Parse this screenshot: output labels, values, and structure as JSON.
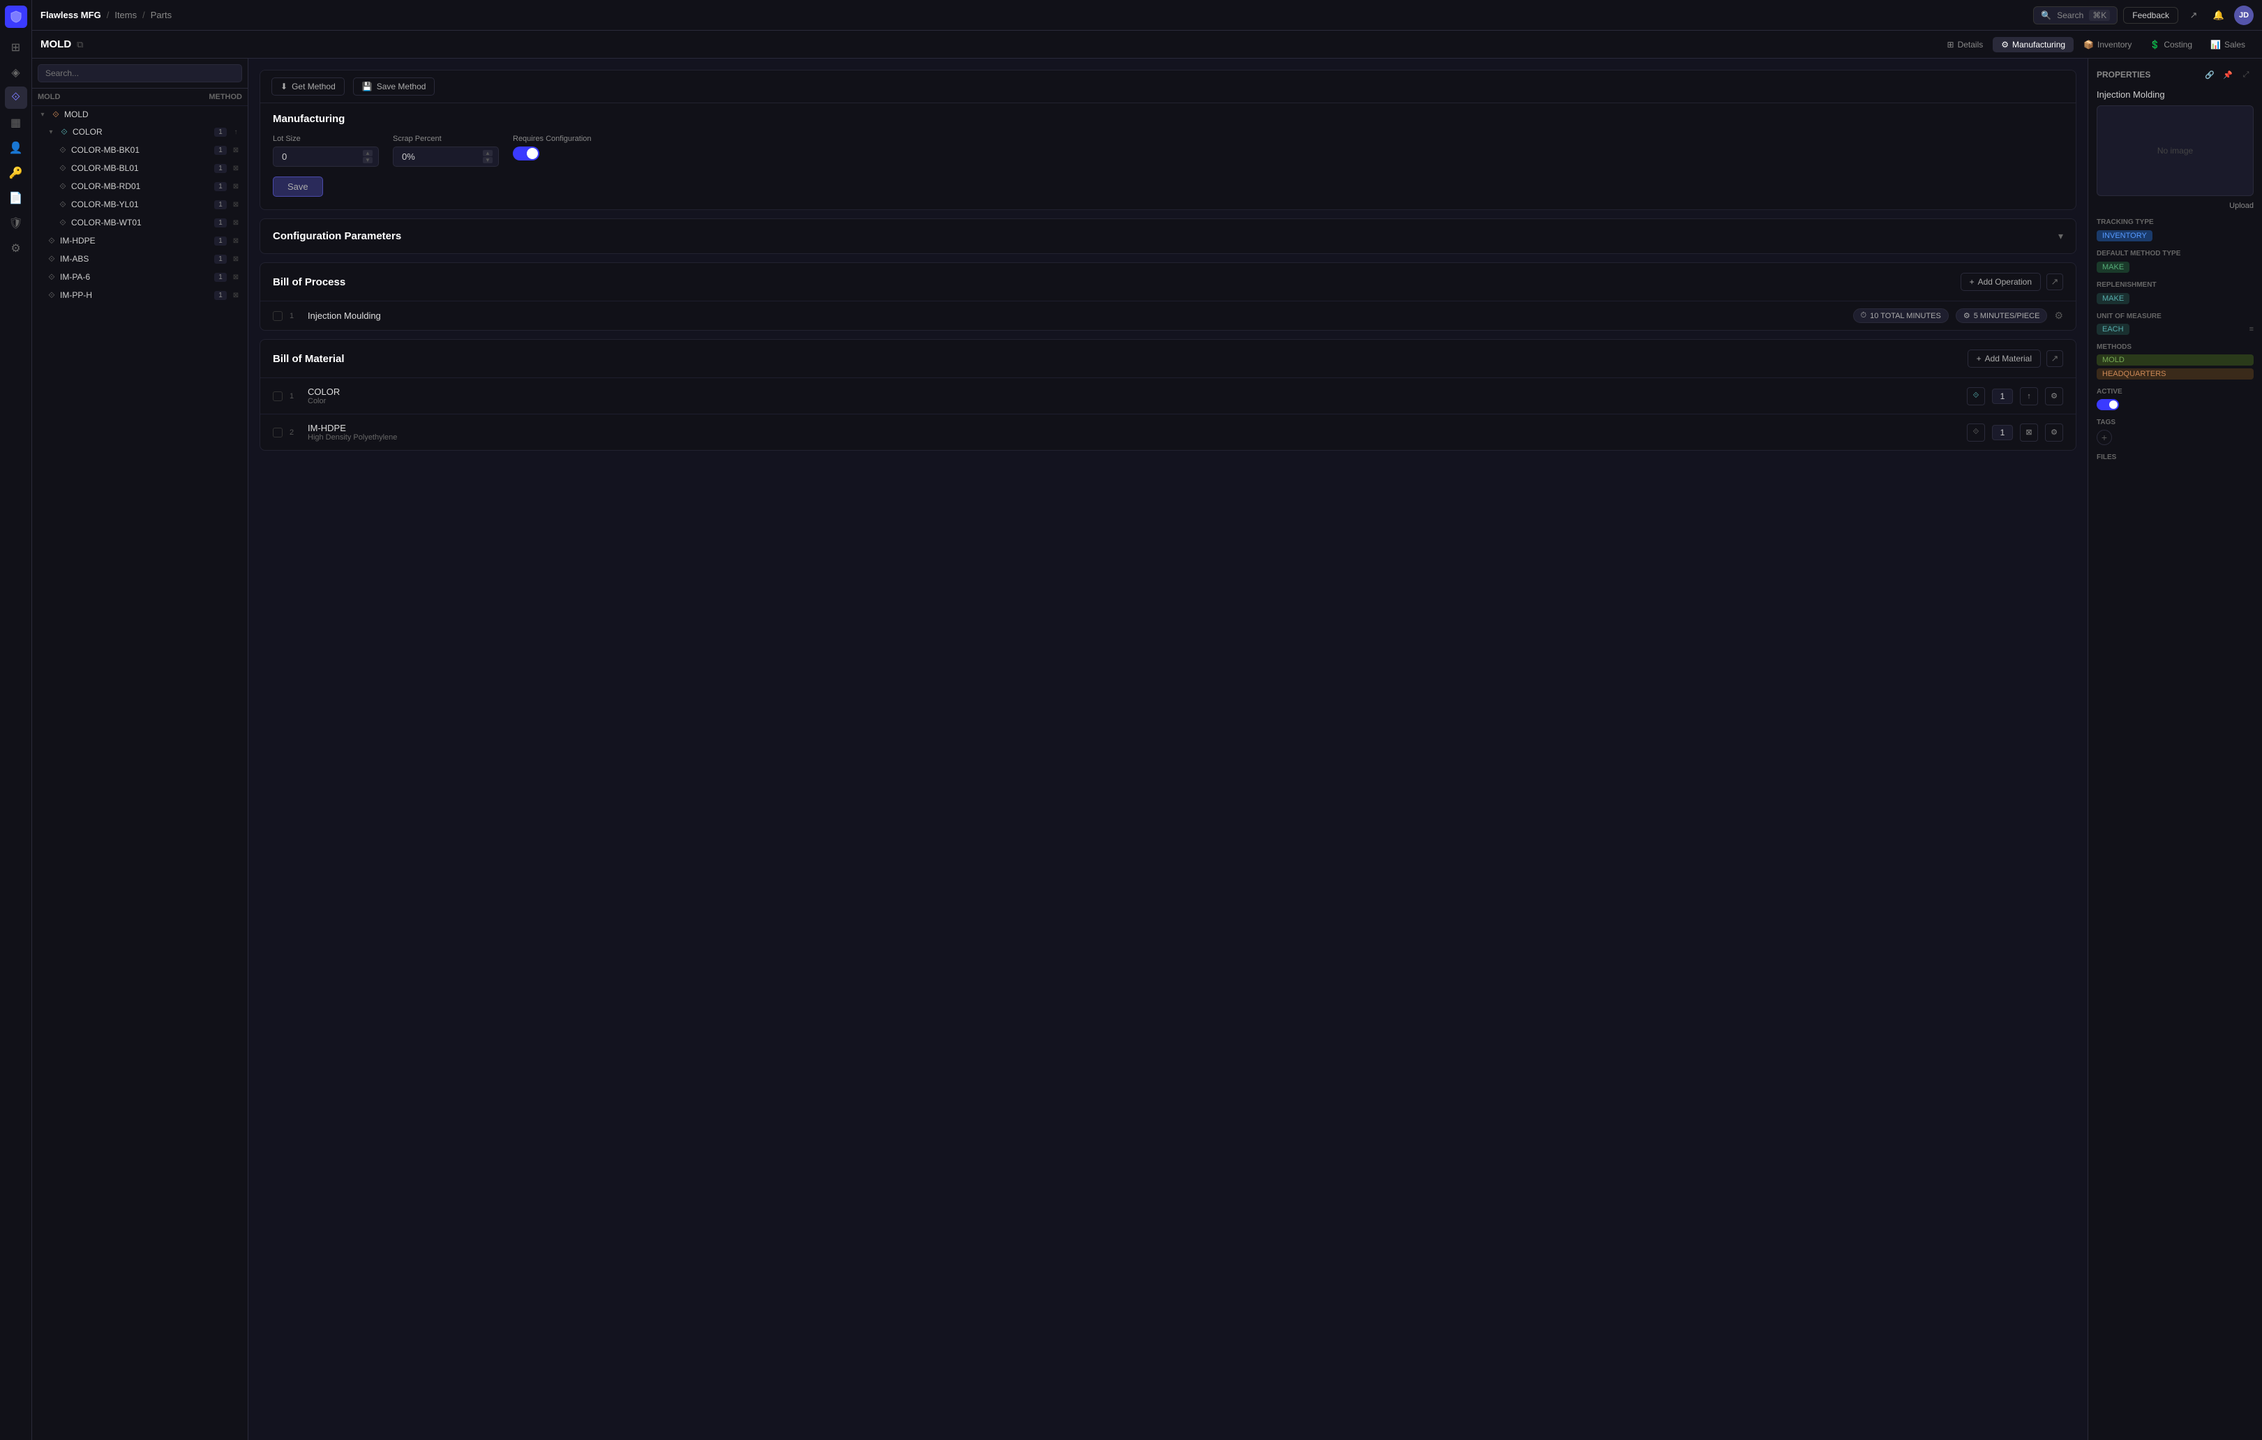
{
  "app": {
    "name": "Flawless MFG",
    "breadcrumbs": [
      "Items",
      "Parts"
    ],
    "page_title": "MOLD"
  },
  "topnav": {
    "search_placeholder": "Search",
    "search_shortcut": "⌘K",
    "feedback_label": "Feedback",
    "tabs": [
      {
        "id": "details",
        "label": "Details",
        "icon": "⊞"
      },
      {
        "id": "manufacturing",
        "label": "Manufacturing",
        "icon": "⚙",
        "active": true
      },
      {
        "id": "inventory",
        "label": "Inventory",
        "icon": "📦"
      },
      {
        "id": "costing",
        "label": "Costing",
        "icon": "💲"
      },
      {
        "id": "sales",
        "label": "Sales",
        "icon": "📊"
      }
    ]
  },
  "tree": {
    "search_placeholder": "Search...",
    "header": {
      "name_col": "MOLD",
      "method_col": "METHOD"
    },
    "items": [
      {
        "id": "mold",
        "label": "MOLD",
        "indent": 0,
        "badge": "",
        "icon": "orange",
        "expanded": true
      },
      {
        "id": "color",
        "label": "COLOR",
        "indent": 1,
        "badge": "1",
        "icon": "teal",
        "expanded": true
      },
      {
        "id": "color-mb-bk01",
        "label": "COLOR-MB-BK01",
        "indent": 2,
        "badge": "1",
        "icon": "gray"
      },
      {
        "id": "color-mb-bl01",
        "label": "COLOR-MB-BL01",
        "indent": 2,
        "badge": "1",
        "icon": "gray"
      },
      {
        "id": "color-mb-rd01",
        "label": "COLOR-MB-RD01",
        "indent": 2,
        "badge": "1",
        "icon": "gray"
      },
      {
        "id": "color-mb-yl01",
        "label": "COLOR-MB-YL01",
        "indent": 2,
        "badge": "1",
        "icon": "gray"
      },
      {
        "id": "color-mb-wt01",
        "label": "COLOR-MB-WT01",
        "indent": 2,
        "badge": "1",
        "icon": "gray"
      },
      {
        "id": "im-hdpe",
        "label": "IM-HDPE",
        "indent": 1,
        "badge": "1",
        "icon": "gray"
      },
      {
        "id": "im-abs",
        "label": "IM-ABS",
        "indent": 1,
        "badge": "1",
        "icon": "gray"
      },
      {
        "id": "im-pa-6",
        "label": "IM-PA-6",
        "indent": 1,
        "badge": "1",
        "icon": "gray"
      },
      {
        "id": "im-pp-h",
        "label": "IM-PP-H",
        "indent": 1,
        "badge": "1",
        "icon": "gray"
      }
    ]
  },
  "manufacturing": {
    "title": "Manufacturing",
    "get_method_label": "Get Method",
    "save_method_label": "Save Method",
    "lot_size_label": "Lot Size",
    "lot_size_value": "0",
    "scrap_percent_label": "Scrap Percent",
    "scrap_percent_value": "0%",
    "requires_config_label": "Requires Configuration",
    "requires_config_on": true,
    "save_label": "Save"
  },
  "config_params": {
    "title": "Configuration Parameters"
  },
  "bill_of_process": {
    "title": "Bill of Process",
    "add_operation_label": "Add Operation",
    "operations": [
      {
        "num": "1",
        "name": "Injection Moulding",
        "total_minutes": "10 TOTAL MINUTES",
        "per_piece": "5 MINUTES/PIECE"
      }
    ]
  },
  "bill_of_material": {
    "title": "Bill of Material",
    "add_material_label": "Add Material",
    "materials": [
      {
        "num": "1",
        "name": "COLOR",
        "sub": "Color",
        "qty": "1",
        "icon": "teal"
      },
      {
        "num": "2",
        "name": "IM-HDPE",
        "sub": "High Density Polyethylene",
        "qty": "1",
        "icon": "gray"
      }
    ]
  },
  "properties": {
    "title": "Properties",
    "item_name": "Injection Molding",
    "no_image_text": "No image",
    "upload_label": "Upload",
    "tracking_type_label": "Tracking Type",
    "tracking_type_value": "INVENTORY",
    "default_method_label": "Default Method Type",
    "default_method_value": "MAKE",
    "replenishment_label": "Replenishment",
    "replenishment_value": "MAKE",
    "uom_label": "Unit of Measure",
    "uom_value": "EACH",
    "methods_label": "Methods",
    "methods": [
      {
        "label": "MOLD",
        "type": "mold"
      },
      {
        "label": "HEADQUARTERS",
        "type": "hq"
      }
    ],
    "active_label": "Active",
    "active": true,
    "tags_label": "Tags",
    "files_label": "Files"
  },
  "icons": {
    "search": "🔍",
    "new_tab": "↗",
    "bell": "🔔",
    "chevron_down": "▾",
    "chevron_right": "▸",
    "copy": "⧉",
    "expand": "⊞",
    "link": "🔗",
    "pin": "📌",
    "maximize": "⤢",
    "gear": "⚙",
    "save": "💾",
    "get": "⬇",
    "plus": "+",
    "settings": "⚙",
    "share": "↑",
    "close": "×",
    "filter": "≡"
  }
}
